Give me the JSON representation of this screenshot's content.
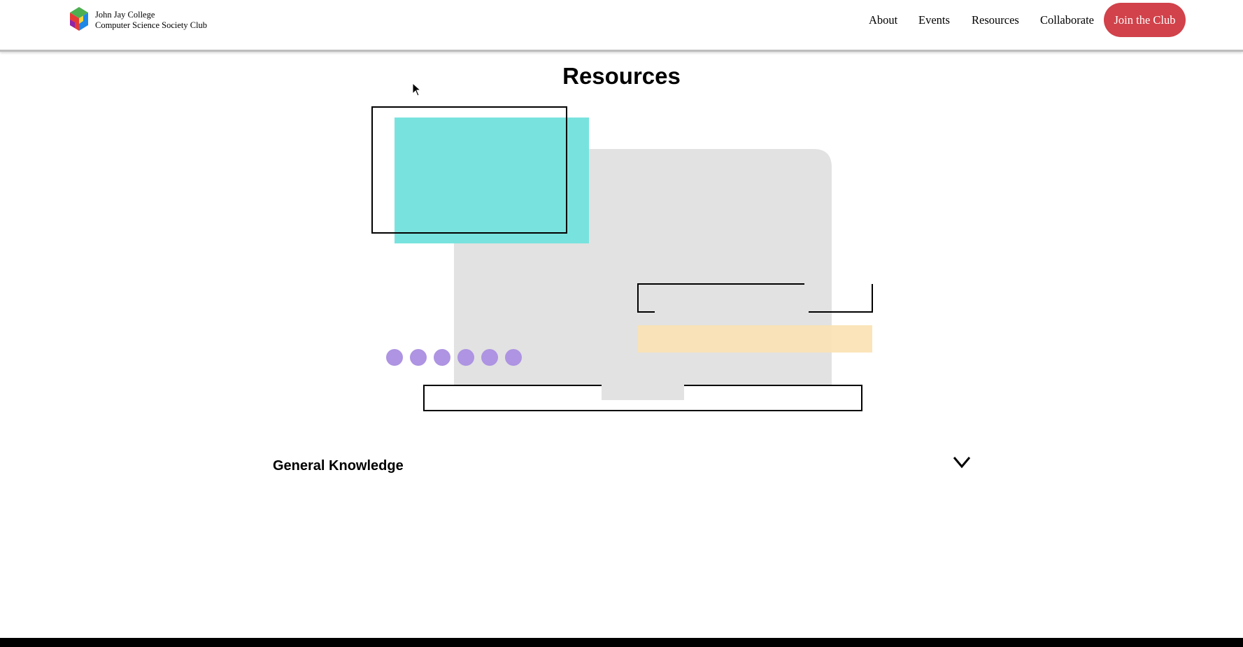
{
  "header": {
    "brand_line1": "John Jay College",
    "brand_line2": "Computer Science Society Club",
    "nav": {
      "about": "About",
      "events": "Events",
      "resources": "Resources",
      "collaborate": "Collaborate"
    },
    "cta_label": "Join the Club"
  },
  "main": {
    "title": "Resources",
    "sections": [
      {
        "label": "General Knowledge",
        "icon": "chevron-down-icon",
        "expanded": false
      }
    ]
  },
  "colors": {
    "accent_red": "#d1424a",
    "teal": "#78e3de",
    "light_gray": "#e2e2e2",
    "peach": "#fbe2b4",
    "purple": "#ae94e2"
  }
}
